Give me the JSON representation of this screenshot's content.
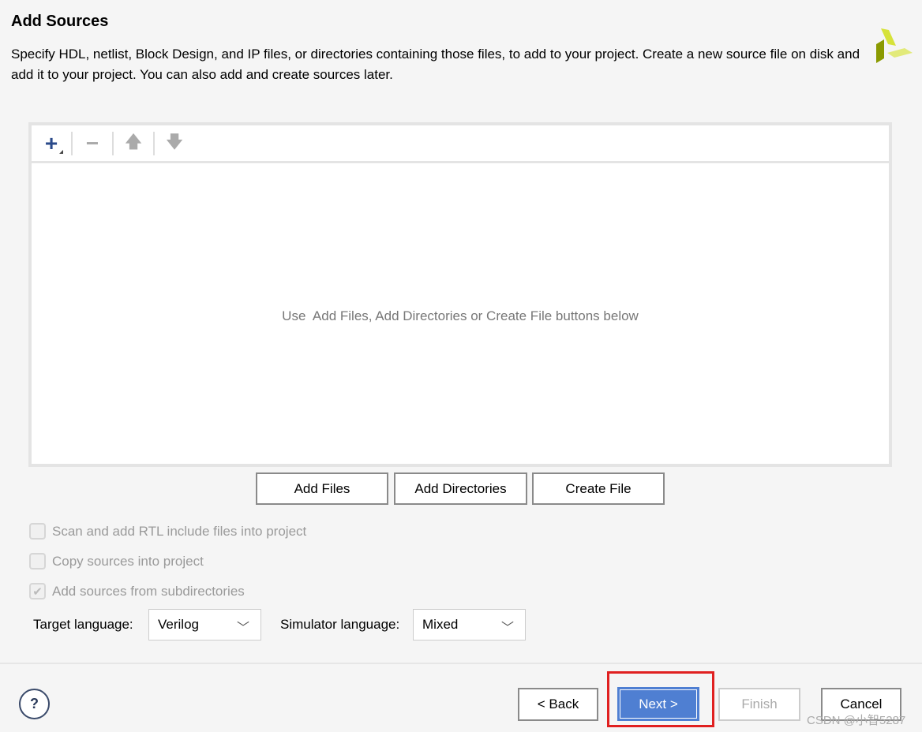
{
  "header": {
    "title": "Add Sources",
    "description": "Specify HDL, netlist, Block Design, and IP files, or directories containing those files, to add to your project. Create a new source file on disk and add it to your project. You can also add and create sources later."
  },
  "colors": {
    "accent": "#4f7fd2",
    "highlight": "#e02020",
    "logo_dark": "#8a9a00",
    "logo_light": "#d4e040"
  },
  "toolbar": {
    "items": [
      "plus-icon",
      "minus-icon",
      "arrow-up-icon",
      "arrow-down-icon"
    ]
  },
  "files_panel": {
    "empty_message": "Use  Add Files, Add Directories or Create File buttons below"
  },
  "buttons": {
    "add_files": "Add Files",
    "add_directories": "Add Directories",
    "create_file": "Create File"
  },
  "options": [
    {
      "label": "Scan and add RTL include files into project",
      "checked": false
    },
    {
      "label": "Copy sources into project",
      "checked": false
    },
    {
      "label": "Add sources from subdirectories",
      "checked": true
    }
  ],
  "languages": {
    "target_label": "Target language:",
    "target_value": "Verilog",
    "sim_label": "Simulator language:",
    "sim_value": "Mixed"
  },
  "footer": {
    "help": "?",
    "back": "< Back",
    "next": "Next >",
    "finish": "Finish",
    "cancel": "Cancel"
  },
  "watermark": "CSDN @小智5287"
}
